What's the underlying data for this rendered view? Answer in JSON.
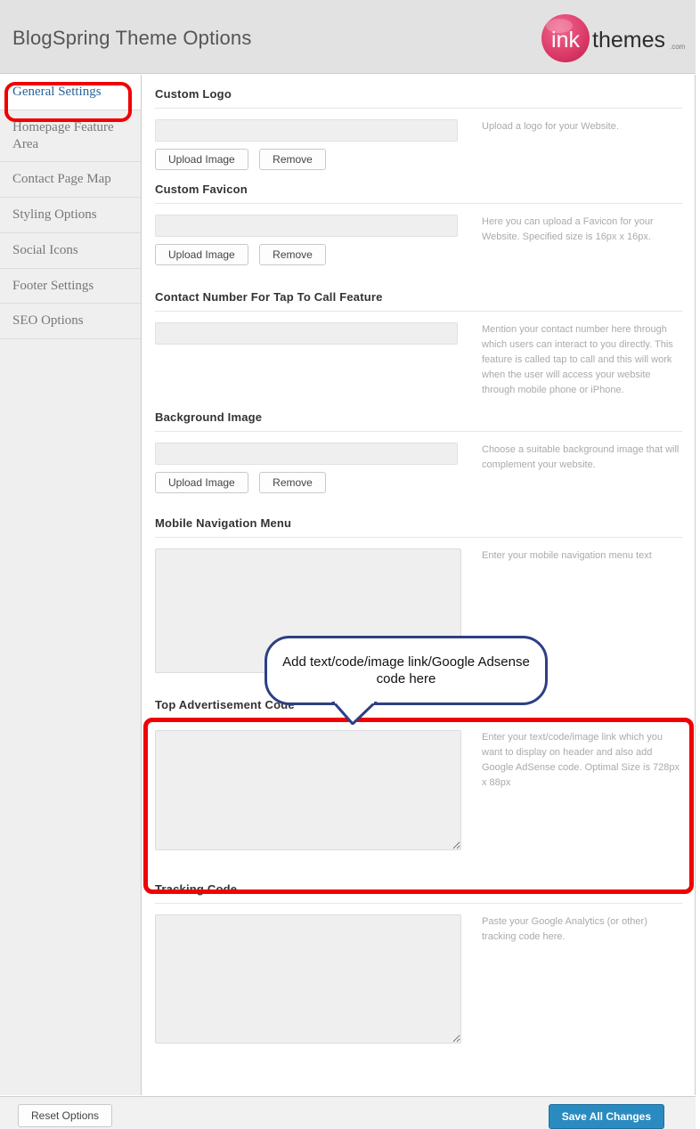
{
  "header": {
    "title": "BlogSpring Theme Options",
    "logo": {
      "mark": "ink",
      "word": "themes",
      "tld": ".com",
      "color": "#e0436f"
    }
  },
  "sidebar": {
    "items": [
      {
        "label": "General Settings",
        "active": true
      },
      {
        "label": "Homepage Feature Area",
        "active": false
      },
      {
        "label": "Contact Page Map",
        "active": false
      },
      {
        "label": "Styling Options",
        "active": false
      },
      {
        "label": "Social Icons",
        "active": false
      },
      {
        "label": "Footer Settings",
        "active": false
      },
      {
        "label": "SEO Options",
        "active": false
      }
    ]
  },
  "buttons": {
    "upload": "Upload Image",
    "remove": "Remove"
  },
  "sections": {
    "logo": {
      "heading": "Custom Logo",
      "value": "",
      "description": "Upload a logo for your Website."
    },
    "favicon": {
      "heading": "Custom Favicon",
      "value": "",
      "description": "Here you can upload a Favicon for your Website. Specified size is 16px x 16px."
    },
    "contact": {
      "heading": "Contact Number For Tap To Call Feature",
      "value": "",
      "description": "Mention your contact number here through which users can interact to you directly. This feature is called tap to call and this will work when the user will access your website through mobile phone or iPhone."
    },
    "background": {
      "heading": "Background Image",
      "value": "",
      "description": "Choose a suitable background image that will complement your website."
    },
    "mobilenav": {
      "heading": "Mobile Navigation Menu",
      "value": "",
      "description": "Enter your mobile navigation menu text"
    },
    "topad": {
      "heading": "Top Advertisement Code",
      "value": "",
      "description": "Enter your text/code/image link which you want to display on header and also add Google AdSense code. Optimal Size is 728px x 88px"
    },
    "tracking": {
      "heading": "Tracking Code",
      "value": "",
      "description": "Paste your Google Analytics (or other) tracking code here."
    }
  },
  "footer": {
    "reset_label": "Reset Options",
    "save_label": "Save All Changes",
    "save_color": "#2a8bc0"
  },
  "annotations": {
    "callout_text": "Add text/code/image link/Google Adsense code here",
    "callout_border_color": "#2e3f83",
    "highlight_color": "#f00000"
  }
}
